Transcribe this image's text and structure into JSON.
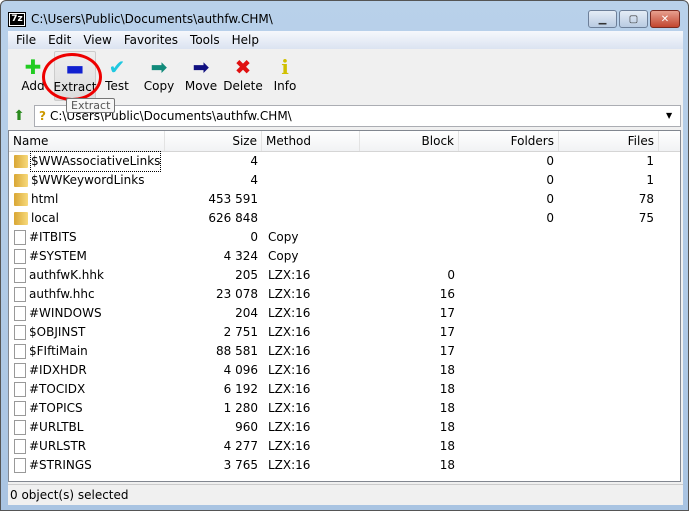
{
  "window": {
    "title": "C:\\Users\\Public\\Documents\\authfw.CHM\\",
    "app_icon": "7z"
  },
  "menu": [
    "File",
    "Edit",
    "View",
    "Favorites",
    "Tools",
    "Help"
  ],
  "toolbar": [
    {
      "label": "Add",
      "icon": "plus-icon",
      "color": "#22cc22",
      "glyph": "✚"
    },
    {
      "label": "Extract",
      "icon": "minus-icon",
      "color": "#1020d0",
      "glyph": "▬"
    },
    {
      "label": "Test",
      "icon": "check-icon",
      "color": "#20c8e0",
      "glyph": "✔"
    },
    {
      "label": "Copy",
      "icon": "copy-arrow-icon",
      "color": "#118a7a",
      "glyph": "➡"
    },
    {
      "label": "Move",
      "icon": "move-arrow-icon",
      "color": "#101080",
      "glyph": "➡"
    },
    {
      "label": "Delete",
      "icon": "delete-x-icon",
      "color": "#e01010",
      "glyph": "✖"
    },
    {
      "label": "Info",
      "icon": "info-icon",
      "color": "#d0c000",
      "glyph": "i"
    }
  ],
  "tooltip": "Extract",
  "address": {
    "value": "C:\\Users\\Public\\Documents\\authfw.CHM\\"
  },
  "columns": [
    "Name",
    "Size",
    "Method",
    "Block",
    "Folders",
    "Files"
  ],
  "rows": [
    {
      "type": "folder",
      "name": "$WWAssociativeLinks",
      "size": "4",
      "method": "",
      "block": "",
      "folders": "0",
      "files": "1"
    },
    {
      "type": "folder",
      "name": "$WWKeywordLinks",
      "size": "4",
      "method": "",
      "block": "",
      "folders": "0",
      "files": "1"
    },
    {
      "type": "folder",
      "name": "html",
      "size": "453 591",
      "method": "",
      "block": "",
      "folders": "0",
      "files": "78"
    },
    {
      "type": "folder",
      "name": "local",
      "size": "626 848",
      "method": "",
      "block": "",
      "folders": "0",
      "files": "75"
    },
    {
      "type": "file",
      "name": "#ITBITS",
      "size": "0",
      "method": "Copy",
      "block": "",
      "folders": "",
      "files": ""
    },
    {
      "type": "file",
      "name": "#SYSTEM",
      "size": "4 324",
      "method": "Copy",
      "block": "",
      "folders": "",
      "files": ""
    },
    {
      "type": "file",
      "name": "authfwK.hhk",
      "size": "205",
      "method": "LZX:16",
      "block": "0",
      "folders": "",
      "files": ""
    },
    {
      "type": "file",
      "name": "authfw.hhc",
      "size": "23 078",
      "method": "LZX:16",
      "block": "16",
      "folders": "",
      "files": ""
    },
    {
      "type": "file",
      "name": "#WINDOWS",
      "size": "204",
      "method": "LZX:16",
      "block": "17",
      "folders": "",
      "files": ""
    },
    {
      "type": "file",
      "name": "$OBJINST",
      "size": "2 751",
      "method": "LZX:16",
      "block": "17",
      "folders": "",
      "files": ""
    },
    {
      "type": "file",
      "name": "$FIftiMain",
      "size": "88 581",
      "method": "LZX:16",
      "block": "17",
      "folders": "",
      "files": ""
    },
    {
      "type": "file",
      "name": "#IDXHDR",
      "size": "4 096",
      "method": "LZX:16",
      "block": "18",
      "folders": "",
      "files": ""
    },
    {
      "type": "file",
      "name": "#TOCIDX",
      "size": "6 192",
      "method": "LZX:16",
      "block": "18",
      "folders": "",
      "files": ""
    },
    {
      "type": "file",
      "name": "#TOPICS",
      "size": "1 280",
      "method": "LZX:16",
      "block": "18",
      "folders": "",
      "files": ""
    },
    {
      "type": "file",
      "name": "#URLTBL",
      "size": "960",
      "method": "LZX:16",
      "block": "18",
      "folders": "",
      "files": ""
    },
    {
      "type": "file",
      "name": "#URLSTR",
      "size": "4 277",
      "method": "LZX:16",
      "block": "18",
      "folders": "",
      "files": ""
    },
    {
      "type": "file",
      "name": "#STRINGS",
      "size": "3 765",
      "method": "LZX:16",
      "block": "18",
      "folders": "",
      "files": ""
    }
  ],
  "status": "0 object(s) selected"
}
